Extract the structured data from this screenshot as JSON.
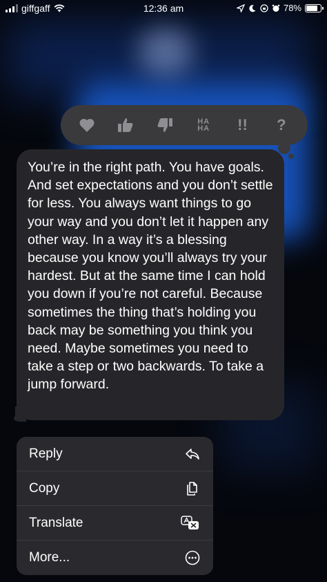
{
  "status_bar": {
    "carrier": "giffgaff",
    "time": "12:36 am",
    "battery_percent": "78%",
    "battery_level": 0.78,
    "icons": [
      "signal-icon",
      "wifi-icon",
      "location-icon",
      "moon-icon",
      "screen-lock-icon",
      "alarm-icon",
      "battery-icon"
    ]
  },
  "tapback": {
    "reactions": [
      "heart-icon",
      "thumbs-up-icon",
      "thumbs-down-icon",
      "haha-icon",
      "exclamation-icon",
      "question-icon"
    ],
    "haha_line1": "HA",
    "haha_line2": "HA",
    "exclamation": "!!",
    "question": "?"
  },
  "message": {
    "text": "You’re in the right path. You have goals. And set expectations and you don’t settle for less. You always want things to go your way and you don’t let it happen any other way. In a way it’s a blessing because you know you’ll always try your hardest. But at the same time I can hold you down if you’re not careful. Because sometimes the thing that’s holding you back may be something you think you need. Maybe sometimes you need to take a step or two backwards. To take a jump forward."
  },
  "context_menu": {
    "items": [
      {
        "label": "Reply",
        "icon": "reply-icon"
      },
      {
        "label": "Copy",
        "icon": "copy-icon"
      },
      {
        "label": "Translate",
        "icon": "translate-icon"
      },
      {
        "label": "More...",
        "icon": "more-icon"
      }
    ]
  },
  "colors": {
    "background": "#05070d",
    "bubble": "#26262a",
    "tapback_bar": "#3a3a3c",
    "menu": "#2a2a2e",
    "tapback_icon": "#8e8e93",
    "blur_accent": "#1a5fd6"
  }
}
